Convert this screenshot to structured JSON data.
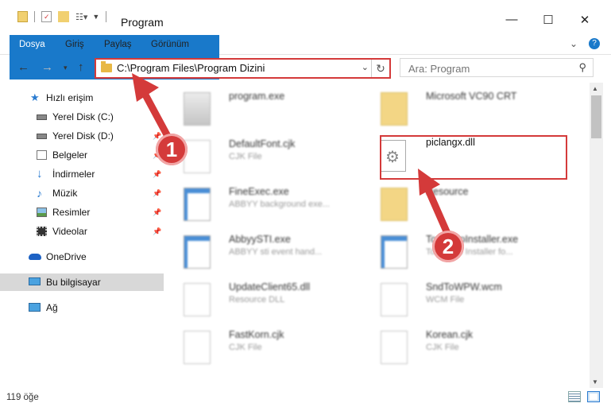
{
  "window": {
    "title": "Program",
    "tabs": [
      "Dosya",
      "Giriş",
      "Paylaş",
      "Görünüm"
    ],
    "help_icon": "question-icon"
  },
  "address": {
    "path": "C:\\Program Files\\Program Dizini",
    "search_placeholder": "Ara: Program"
  },
  "sidebar": {
    "items": [
      {
        "label": "Hızlı erişim",
        "icon": "star-icon"
      },
      {
        "label": "Yerel Disk (C:)",
        "icon": "drive-icon"
      },
      {
        "label": "Yerel Disk (D:)",
        "icon": "drive-icon"
      },
      {
        "label": "Belgeler",
        "icon": "documents-icon"
      },
      {
        "label": "İndirmeler",
        "icon": "download-icon"
      },
      {
        "label": "Müzik",
        "icon": "music-icon"
      },
      {
        "label": "Resimler",
        "icon": "pictures-icon"
      },
      {
        "label": "Videolar",
        "icon": "videos-icon"
      },
      {
        "label": "OneDrive",
        "icon": "cloud-icon"
      },
      {
        "label": "Bu bilgisayar",
        "icon": "computer-icon"
      },
      {
        "label": "Ağ",
        "icon": "network-icon"
      }
    ]
  },
  "files": [
    {
      "name": "program.exe",
      "type": ""
    },
    {
      "name": "Microsoft VC90 CRT",
      "type": ""
    },
    {
      "name": "DefaultFont.cjk",
      "type": "CJK File"
    },
    {
      "name": "piclangx.dll",
      "type": ""
    },
    {
      "name": "FineExec.exe",
      "type": "ABBYY background exe..."
    },
    {
      "name": "Resource",
      "type": ""
    },
    {
      "name": "AbbyySTI.exe",
      "type": "ABBYY sti event hand..."
    },
    {
      "name": "TouchUpInstaller.exe",
      "type": "Touch Up Installer fo..."
    },
    {
      "name": "UpdateClient65.dll",
      "type": "Resource DLL"
    },
    {
      "name": "SndToWPW.wcm",
      "type": "WCM File"
    },
    {
      "name": "FastKorn.cjk",
      "type": "CJK File"
    },
    {
      "name": "Korean.cjk",
      "type": "CJK File"
    }
  ],
  "status": {
    "count": "119 öğe"
  },
  "annotations": {
    "step1": "1",
    "step2": "2"
  },
  "colors": {
    "accent": "#1979ca",
    "highlight": "#d43a3a",
    "folder": "#e8b845"
  }
}
